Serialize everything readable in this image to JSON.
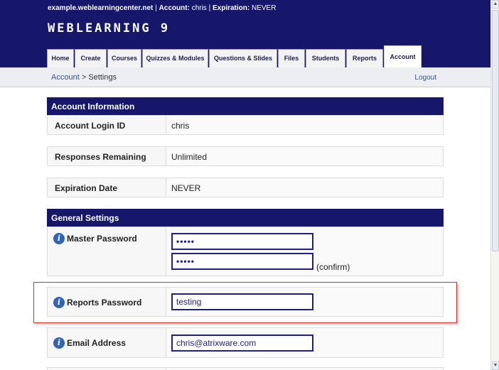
{
  "header": {
    "domain": "example.weblearningcenter.net",
    "account_label": "Account:",
    "account_value": "chris",
    "expiration_label": "Expiration:",
    "expiration_value": "NEVER",
    "logo": "WEBLEARNING 9"
  },
  "tabs": [
    {
      "label": "Home"
    },
    {
      "label": "Create"
    },
    {
      "label": "Courses"
    },
    {
      "label": "Quizzes & Modules"
    },
    {
      "label": "Questions & Slides"
    },
    {
      "label": "Files"
    },
    {
      "label": "Students"
    },
    {
      "label": "Reports"
    },
    {
      "label": "Account",
      "active": true
    }
  ],
  "subnav": {
    "breadcrumb_link": "Account",
    "breadcrumb_sep": ">",
    "breadcrumb_current": "Settings",
    "logout": "Logout"
  },
  "account_info": {
    "title": "Account Information",
    "login_label": "Account Login ID",
    "login_value": "chris",
    "responses_label": "Responses Remaining",
    "responses_value": "Unlimited",
    "expiration_label": "Expiration Date",
    "expiration_value": "NEVER"
  },
  "general": {
    "title": "General Settings",
    "master_password_label": "Master Password",
    "master_password_value": "•••••",
    "master_password_confirm_value": "•••••",
    "confirm_label": "(confirm)",
    "reports_password_label": "Reports Password",
    "reports_password_value": "testing",
    "email_label": "Email Address",
    "email_value": "chris@atrixware.com"
  },
  "icons": {
    "info": "info-icon",
    "scroll_up": "up-arrow-icon",
    "scroll_down": "down-arrow-icon"
  },
  "colors": {
    "header_bg": "#16166b",
    "link": "#2e52a8",
    "highlight_border": "#cc3333"
  }
}
